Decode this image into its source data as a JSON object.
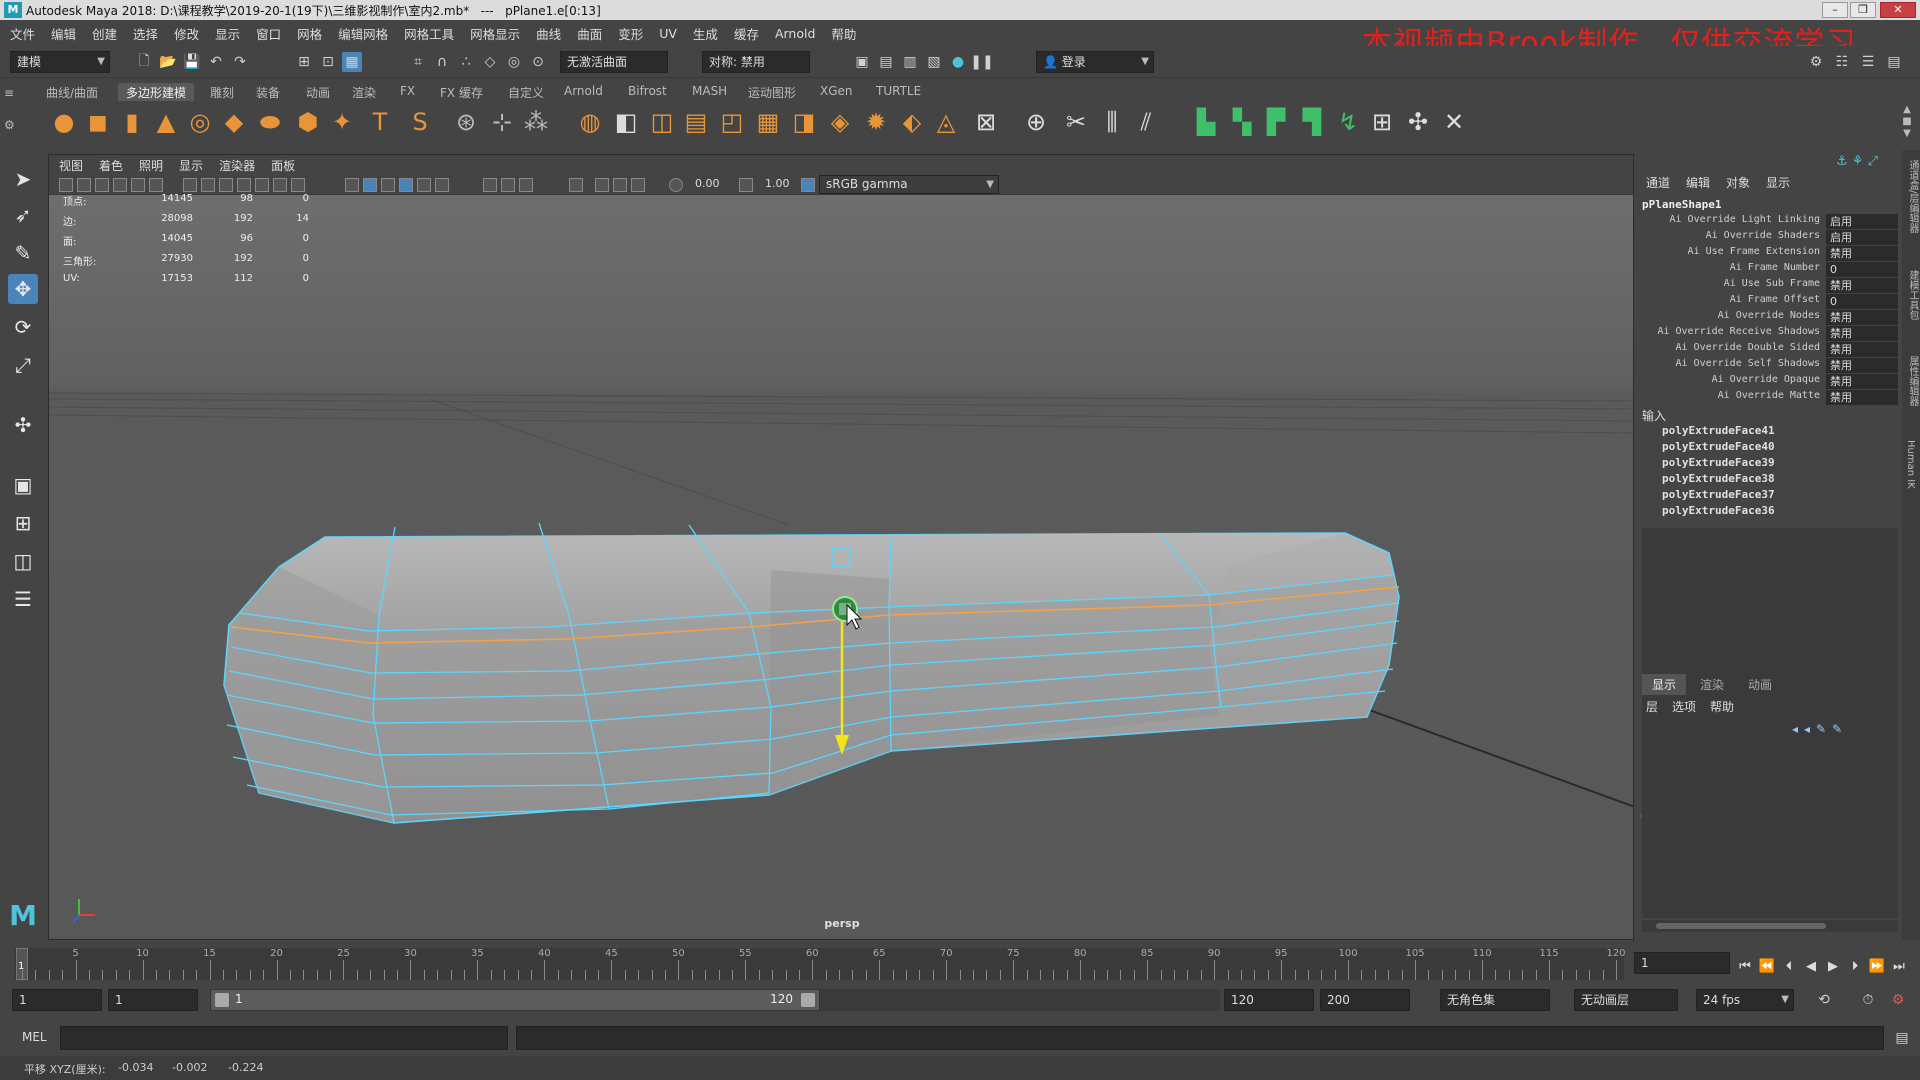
{
  "title_bar": {
    "text": "Autodesk Maya 2018: D:\\课程教学\\2019-20-1(19下)\\三维影视制作\\室内2.mb*   ---   pPlane1.e[0:13]"
  },
  "watermark": "本视频由Brook制作，仅供交流学习。",
  "menu": [
    "文件",
    "编辑",
    "创建",
    "选择",
    "修改",
    "显示",
    "窗口",
    "网格",
    "编辑网格",
    "网格工具",
    "网格显示",
    "曲线",
    "曲面",
    "变形",
    "UV",
    "生成",
    "缓存",
    "Arnold",
    "帮助"
  ],
  "status_line": {
    "mode": "建模",
    "live_surface": "无激活曲面",
    "symmetry": "对称: 禁用",
    "login": "登录"
  },
  "shelf_tabs": [
    "曲线/曲面",
    "多边形建模",
    "雕刻",
    "装备",
    "动画",
    "渲染",
    "FX",
    "FX 缓存",
    "自定义",
    "Arnold",
    "Bifrost",
    "MASH",
    "运动图形",
    "XGen",
    "TURTLE"
  ],
  "shelf_active": "多边形建模",
  "viewport": {
    "menu": [
      "视图",
      "着色",
      "照明",
      "显示",
      "渲染器",
      "面板"
    ],
    "exposure": "0.00",
    "gamma": "1.00",
    "color_space": "sRGB gamma",
    "camera": "persp",
    "hud": [
      {
        "label": "顶点:",
        "total": "14145",
        "selected": "98",
        "tri": "0"
      },
      {
        "label": "边:",
        "total": "28098",
        "selected": "192",
        "tri": "14"
      },
      {
        "label": "面:",
        "total": "14045",
        "selected": "96",
        "tri": "0"
      },
      {
        "label": "三角形:",
        "total": "27930",
        "selected": "192",
        "tri": "0"
      },
      {
        "label": "UV:",
        "total": "17153",
        "selected": "112",
        "tri": "0"
      }
    ]
  },
  "channel_box": {
    "tabs": [
      "通道",
      "编辑",
      "对象",
      "显示"
    ],
    "node": "pPlaneShape1",
    "attributes": [
      {
        "name": "Ai Override Light Linking",
        "value": "启用"
      },
      {
        "name": "Ai Override Shaders",
        "value": "启用"
      },
      {
        "name": "Ai Use Frame Extension",
        "value": "禁用"
      },
      {
        "name": "Ai Frame Number",
        "value": "0"
      },
      {
        "name": "Ai Use Sub Frame",
        "value": "禁用"
      },
      {
        "name": "Ai Frame Offset",
        "value": "0"
      },
      {
        "name": "Ai Override Nodes",
        "value": "禁用"
      },
      {
        "name": "Ai Override Receive Shadows",
        "value": "禁用"
      },
      {
        "name": "Ai Override Double Sided",
        "value": "禁用"
      },
      {
        "name": "Ai Override Self Shadows",
        "value": "禁用"
      },
      {
        "name": "Ai Override Opaque",
        "value": "禁用"
      },
      {
        "name": "Ai Override Matte",
        "value": "禁用"
      }
    ],
    "inputs_label": "输入",
    "inputs": [
      "polyExtrudeFace41",
      "polyExtrudeFace40",
      "polyExtrudeFace39",
      "polyExtrudeFace38",
      "polyExtrudeFace37",
      "polyExtrudeFace36"
    ]
  },
  "layer_editor": {
    "tabs": [
      "显示",
      "渲染",
      "动画"
    ],
    "menu": [
      "层",
      "选项",
      "帮助"
    ]
  },
  "right_strip_labels": [
    "通道盒/层编辑器",
    "建模工具包",
    "属性编辑器",
    "Human IK"
  ],
  "time_slider": {
    "ticks": [
      "5",
      "10",
      "15",
      "20",
      "25",
      "30",
      "35",
      "40",
      "45",
      "50",
      "55",
      "60",
      "65",
      "70",
      "75",
      "80",
      "85",
      "90",
      "95",
      "100",
      "105",
      "110",
      "115",
      "120"
    ],
    "current_frame_marker": "1",
    "current_frame_field": "1"
  },
  "range": {
    "start": "1",
    "playback_start": "1",
    "slider_left": "1",
    "slider_right": "120",
    "playback_end": "120",
    "end": "200",
    "character_set": "无角色集",
    "anim_layer": "无动画层",
    "fps": "24 fps"
  },
  "command_line": {
    "label": "MEL"
  },
  "help_line": {
    "label": "平移 XYZ(厘米):",
    "x": "-0.034",
    "y": "-0.002",
    "z": "-0.224"
  },
  "colors": {
    "accent": "#4b84b9",
    "wireframe": "#5ad6ff",
    "watermark": "#e3211c",
    "manipulator": "#f2e51b"
  }
}
